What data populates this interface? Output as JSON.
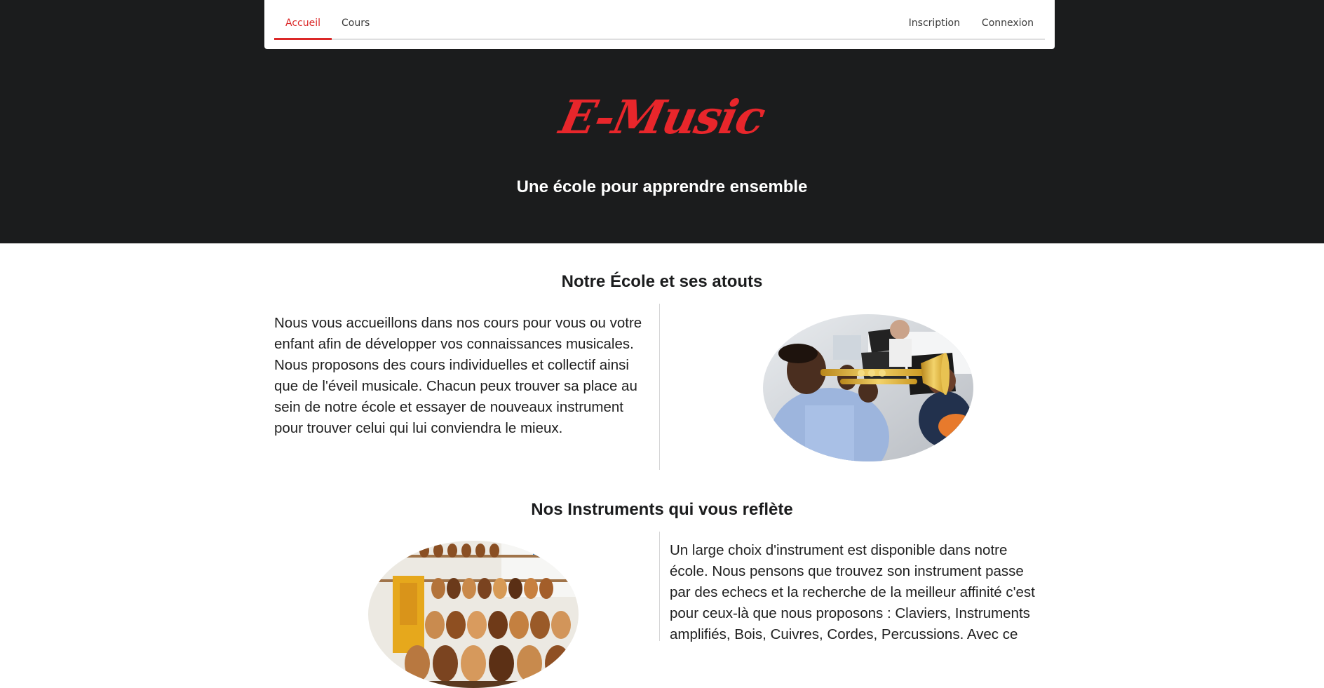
{
  "nav": {
    "home": "Accueil",
    "courses": "Cours",
    "signup": "Inscription",
    "login": "Connexion"
  },
  "hero": {
    "logo": "E-Music",
    "tagline": "Une école pour apprendre ensemble"
  },
  "school": {
    "title": "Notre École et ses atouts",
    "text": "Nous vous accueillons dans nos cours pour vous ou votre enfant afin de développer vos connaissances musicales. Nous proposons des cours individuelles et collectif ainsi que de l'éveil musicale. Chacun peux trouver sa place au sein de notre école et essayer de nouveaux instrument pour trouver celui qui lui conviendra le mieux.",
    "image_icon": "trumpet-student-photo"
  },
  "instruments": {
    "title": "Nos Instruments qui vous reflète",
    "text": "Un large choix d'instrument est disponible dans notre école. Nous pensons que trouvez son instrument passe par des echecs et la recherche de la meilleur affinité c'est pour ceux-là que nous proposons : Claviers, Instruments amplifiés, Bois, Cuivres, Cordes, Percussions. Avec ce",
    "image_icon": "guitar-shop-photo"
  },
  "colors": {
    "accent": "#db2828",
    "logo": "#e8262b",
    "hero_bg": "#1b1c1d"
  }
}
